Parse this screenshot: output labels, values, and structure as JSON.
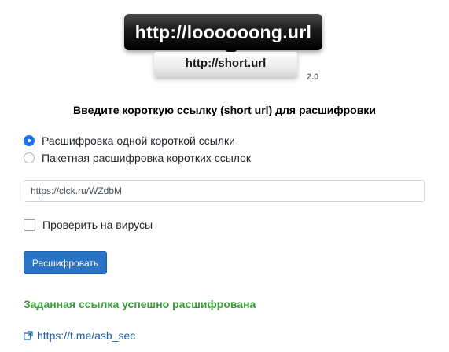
{
  "logo": {
    "long_url": "http://loooooong.url",
    "short_url": "http://short.url",
    "version": "2.0"
  },
  "heading": "Введите короткую ссылку (short url) для расшифровки",
  "mode_options": [
    {
      "label": "Расшифровка одной короткой ссылки",
      "selected": true
    },
    {
      "label": "Пакетная расшифровка коротких ссылок",
      "selected": false
    }
  ],
  "url_input": {
    "value": "https://clck.ru/WZdbM"
  },
  "virus_check": {
    "label": "Проверить на вирусы",
    "checked": false
  },
  "submit_label": "Расшифровать",
  "status": {
    "message": "Заданная ссылка успешно расшифрована",
    "color": "#3a9b3a"
  },
  "result": {
    "url": "https://t.me/asb_sec",
    "icon": "external-link-icon"
  },
  "colors": {
    "accent": "#2a74c6",
    "link": "#1f5fa8",
    "radio_selected": "#1a73e8"
  }
}
